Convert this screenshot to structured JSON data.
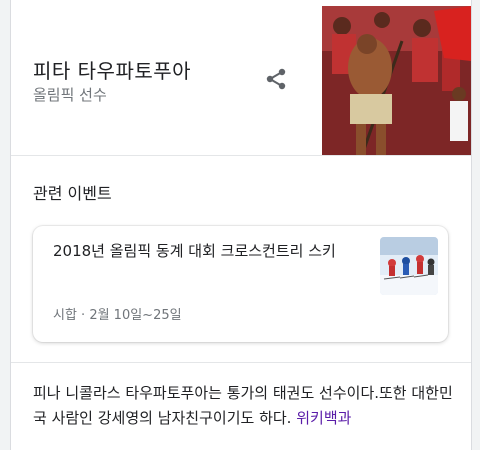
{
  "entity": {
    "title": "피타 타우파토푸아",
    "subtitle": "올림픽 선수"
  },
  "icons": {
    "share": "share-icon"
  },
  "related_events": {
    "heading": "관련 이벤트",
    "items": [
      {
        "title": "2018년 올림픽 동계 대회 크로스컨트리 스키",
        "meta": "시합 · 2월 10일~25일"
      }
    ]
  },
  "description": {
    "text": "피나 니콜라스 타우파토푸아는 통가의 태권도 선수이다.또한 대한민국 사람인 강세영의 남자친구이기도 하다.",
    "source_link": "위키백과"
  },
  "colors": {
    "link": "#5a1ca8",
    "secondary_text": "#70757a",
    "background": "#f1f3f4"
  }
}
